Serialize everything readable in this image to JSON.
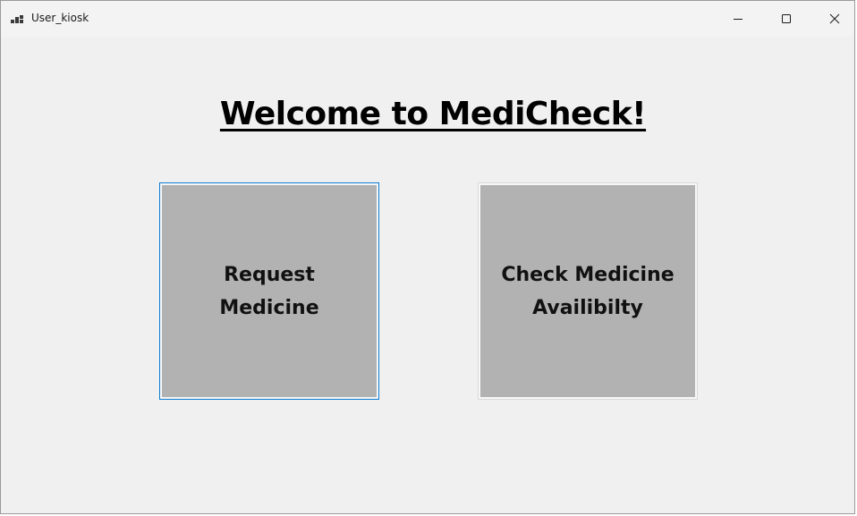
{
  "window": {
    "title": "User_kiosk",
    "icon": "app-window-icon",
    "controls": {
      "minimize_icon": "minimize-icon",
      "maximize_icon": "maximize-icon",
      "close_icon": "close-icon"
    }
  },
  "main": {
    "heading": "Welcome to MediCheck!",
    "buttons": {
      "request_medicine": {
        "line1": "Request",
        "line2": "Medicine"
      },
      "check_availability": {
        "line1": "Check Medicine",
        "line2": "Availibilty"
      }
    }
  },
  "colors": {
    "window_background": "#f0f0f0",
    "button_background": "#b2b2b2",
    "focus_border": "#0a7ad0",
    "heading_text": "#000000"
  }
}
